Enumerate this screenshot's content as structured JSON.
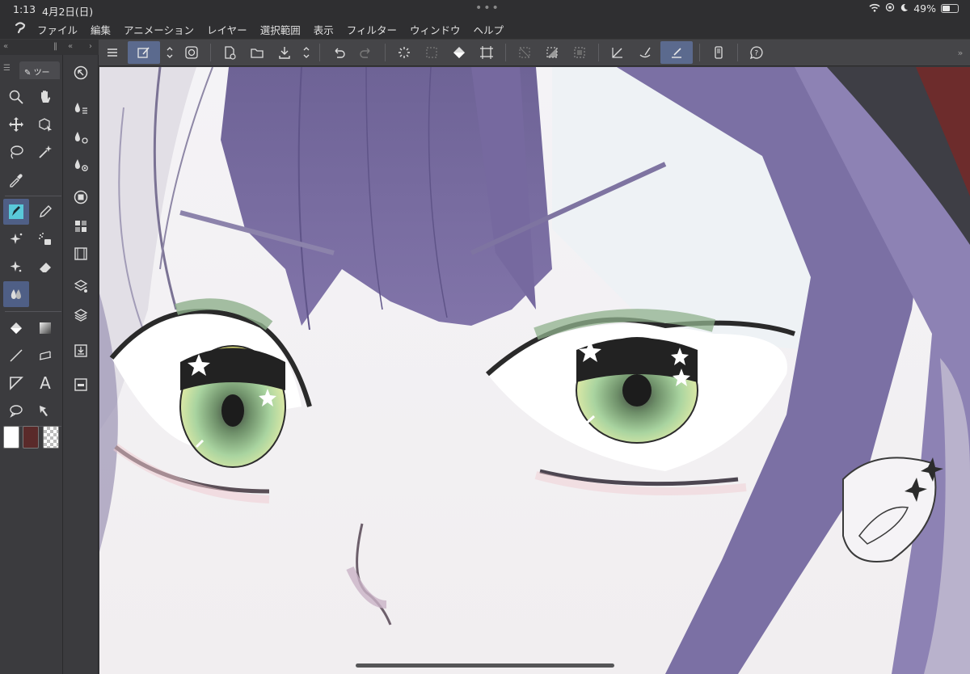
{
  "status_bar": {
    "time": "1:13",
    "date": "4月2日(日)",
    "battery": "49%",
    "battery_level": 0.49
  },
  "menu": {
    "logo_icon": "clip-studio-logo",
    "items": [
      "ファイル",
      "編集",
      "アニメーション",
      "レイヤー",
      "選択範囲",
      "表示",
      "フィルター",
      "ウィンドウ",
      "ヘルプ"
    ]
  },
  "tool_palette": {
    "tab_label": "ツー",
    "colors": {
      "main": "#ffffff",
      "sub": "#5a2a2a",
      "transparent": "checker"
    }
  },
  "theme": {
    "accent": "#5b6a8e",
    "hair": "#7a6ea3",
    "eye_green": "#a9d4a0"
  }
}
